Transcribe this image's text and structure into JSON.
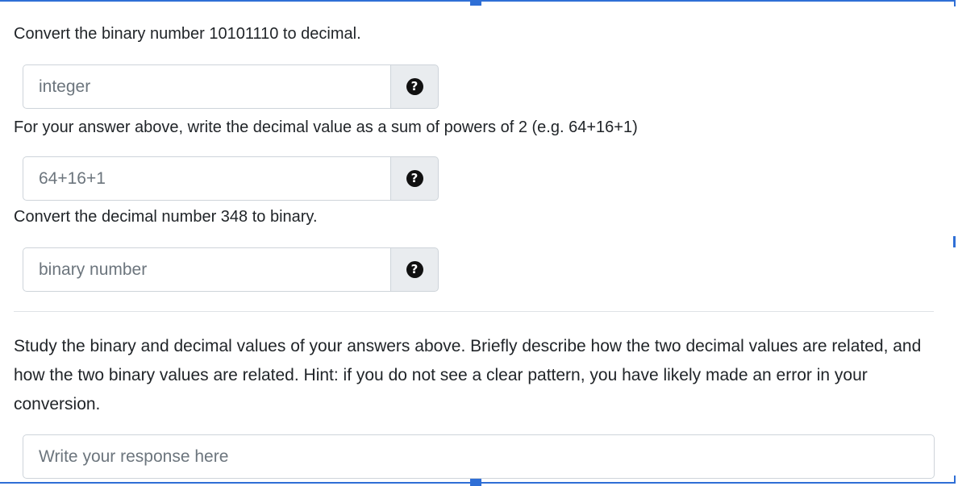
{
  "questions": [
    {
      "prompt": "Convert the binary number 10101110 to decimal.",
      "placeholder": "integer",
      "help_icon": "question-circle-icon"
    },
    {
      "prompt": "For your answer above, write the decimal value as a sum of powers of 2 (e.g. 64+16+1)",
      "placeholder": "64+16+1",
      "help_icon": "question-circle-icon"
    },
    {
      "prompt": "Convert the decimal number 348 to binary.",
      "placeholder": "binary number",
      "help_icon": "question-circle-icon"
    }
  ],
  "study": {
    "text": "Study the binary and decimal values of your answers above. Briefly describe how the two decimal values are related, and how the two binary values are related. Hint: if you do not see a clear pattern, you have likely made an error in your conversion.",
    "placeholder": "Write your response here"
  },
  "colors": {
    "selection_frame": "#2f6fd6",
    "addon_background": "#e9ecef",
    "border": "#ced4da"
  }
}
